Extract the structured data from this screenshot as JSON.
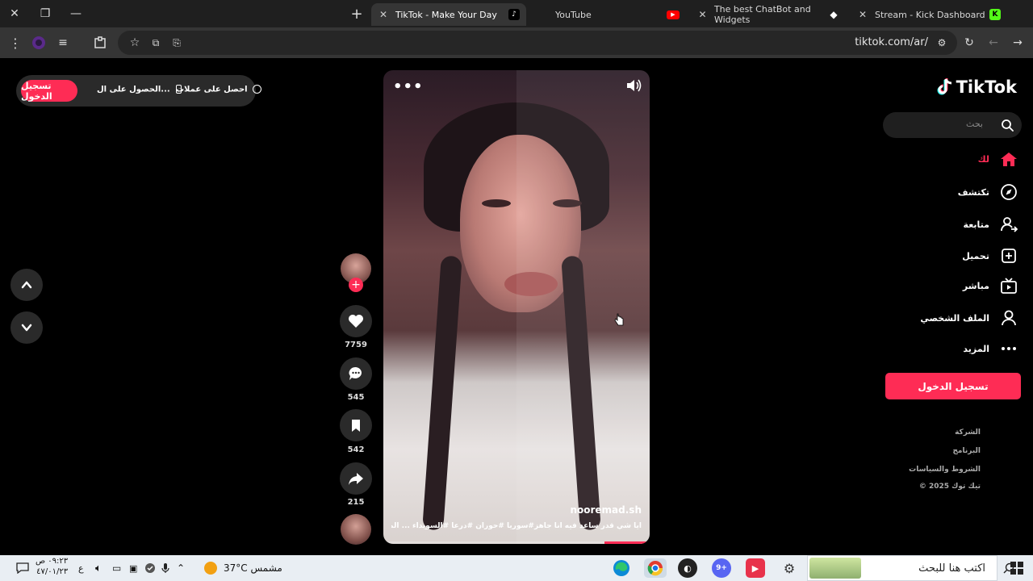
{
  "browser": {
    "tabs": [
      {
        "title": "TikTok - Make Your Day",
        "active": true,
        "favicon": "tiktok-icon"
      },
      {
        "title": "YouTube",
        "active": false,
        "favicon": "youtube-icon"
      },
      {
        "title": "The best ChatBot and Widgets",
        "active": false,
        "favicon": "diamond-icon"
      },
      {
        "title": "Stream - Kick Dashboard",
        "active": false,
        "favicon": "kick-icon"
      }
    ],
    "url": "tiktok.com/ar/"
  },
  "page": {
    "login_button_top": "تسجيل الدخول",
    "get_app": "الحصول على ال...",
    "get_coins": "احصل على عملات",
    "video": {
      "username": "nooremad.sh",
      "caption": "أيا شي قدر ساعد فيه أنا جاهز#سوريا #حوران #درعا #السويداء ... المزيد",
      "progress": 0.17
    },
    "actions": {
      "likes": "7759",
      "comments": "545",
      "saves": "542",
      "shares": "215"
    },
    "sidebar": {
      "logo": "TikTok",
      "search_placeholder": "بحث",
      "nav": [
        {
          "label": "لك",
          "icon": "home-icon",
          "active": true
        },
        {
          "label": "تكتشف",
          "icon": "compass-icon",
          "active": false
        },
        {
          "label": "متابعة",
          "icon": "user-follow-icon",
          "active": false
        },
        {
          "label": "تحميل",
          "icon": "upload-icon",
          "active": false
        },
        {
          "label": "مباشر",
          "icon": "live-tv-icon",
          "active": false
        },
        {
          "label": "الملف الشخصي",
          "icon": "profile-icon",
          "active": false
        },
        {
          "label": "المزيد",
          "icon": "more-icon",
          "active": false
        }
      ],
      "login_button": "تسجيل الدخول",
      "footer": [
        "الشركة",
        "البرنامج",
        "الشروط والسياسات",
        "© 2025 تيك توك"
      ]
    }
  },
  "taskbar": {
    "search_placeholder": "اكتب هنا للبحث",
    "weather": "37°C  مشمس",
    "time": "٠٩:٢٣ ص",
    "date": "٤٧/٠١/٢٣",
    "lang": "ع",
    "notification_badge": "9+"
  },
  "colors": {
    "accent": "#fe2c55",
    "background": "#000000"
  }
}
